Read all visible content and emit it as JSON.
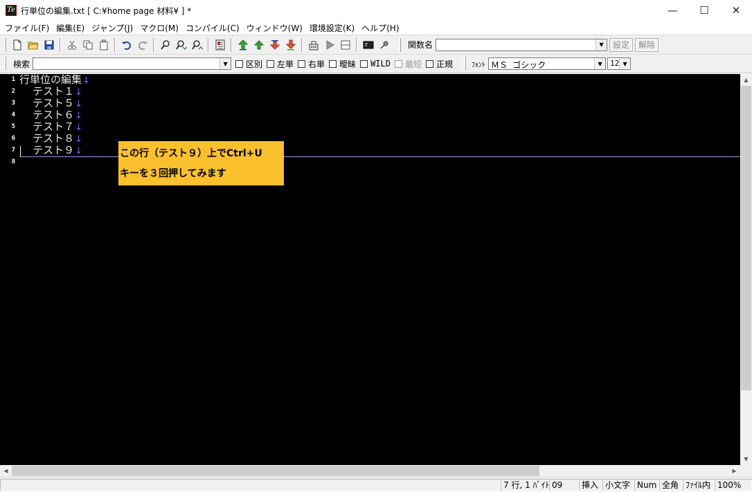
{
  "window": {
    "title": "行単位の編集.txt [ C:¥home page 材料¥ ] *",
    "app_icon_text": "Te"
  },
  "window_controls": {
    "minimize": "—",
    "maximize": "☐",
    "close": "✕"
  },
  "menu": [
    "ファイル(F)",
    "編集(E)",
    "ジャンプ(J)",
    "マクロ(M)",
    "コンパイル(C)",
    "ウィンドウ(W)",
    "環境設定(K)",
    "ヘルプ(H)"
  ],
  "toolbar": {
    "function_label": "関数名",
    "function_value": "",
    "set_button": "設定",
    "clear_button": "解除"
  },
  "searchbar": {
    "search_label": "検索",
    "search_value": "",
    "options": [
      {
        "label": "区別",
        "checked": false,
        "enabled": true
      },
      {
        "label": "左単",
        "checked": false,
        "enabled": true
      },
      {
        "label": "右単",
        "checked": false,
        "enabled": true
      },
      {
        "label": "曖昧",
        "checked": false,
        "enabled": true
      },
      {
        "label": "WILD",
        "checked": false,
        "enabled": true
      },
      {
        "label": "最短",
        "checked": false,
        "enabled": false
      },
      {
        "label": "正規",
        "checked": false,
        "enabled": true
      }
    ],
    "font_label": "ﾌｫﾝﾄ",
    "font_value": "ＭＳ ゴシック",
    "size_value": "12"
  },
  "editor": {
    "lines": [
      {
        "num": "1",
        "text": "行単位の編集"
      },
      {
        "num": "2",
        "text": "    テスト１"
      },
      {
        "num": "3",
        "text": "    テスト５"
      },
      {
        "num": "4",
        "text": "    テスト６"
      },
      {
        "num": "5",
        "text": "    テスト７"
      },
      {
        "num": "6",
        "text": "    テスト８"
      },
      {
        "num": "7",
        "text": "    テスト９"
      },
      {
        "num": "8",
        "text": ""
      }
    ],
    "eol_mark": "↓",
    "callout": {
      "line1": "この行（テスト９）上でCtrl+U",
      "line2": "キーを３回押してみます"
    }
  },
  "status": {
    "position": "7 行, 1 ﾊﾞｲﾄ",
    "char_code": "09",
    "mode": "挿入",
    "case": "小文字",
    "num": "Num",
    "width": "全角",
    "scope": "ﾌｧｲﾙ内",
    "zoom": "100%"
  },
  "colors": {
    "editor_bg": "#000000",
    "callout_bg": "#fbc02d",
    "eol_mark": "#6a6aff"
  }
}
